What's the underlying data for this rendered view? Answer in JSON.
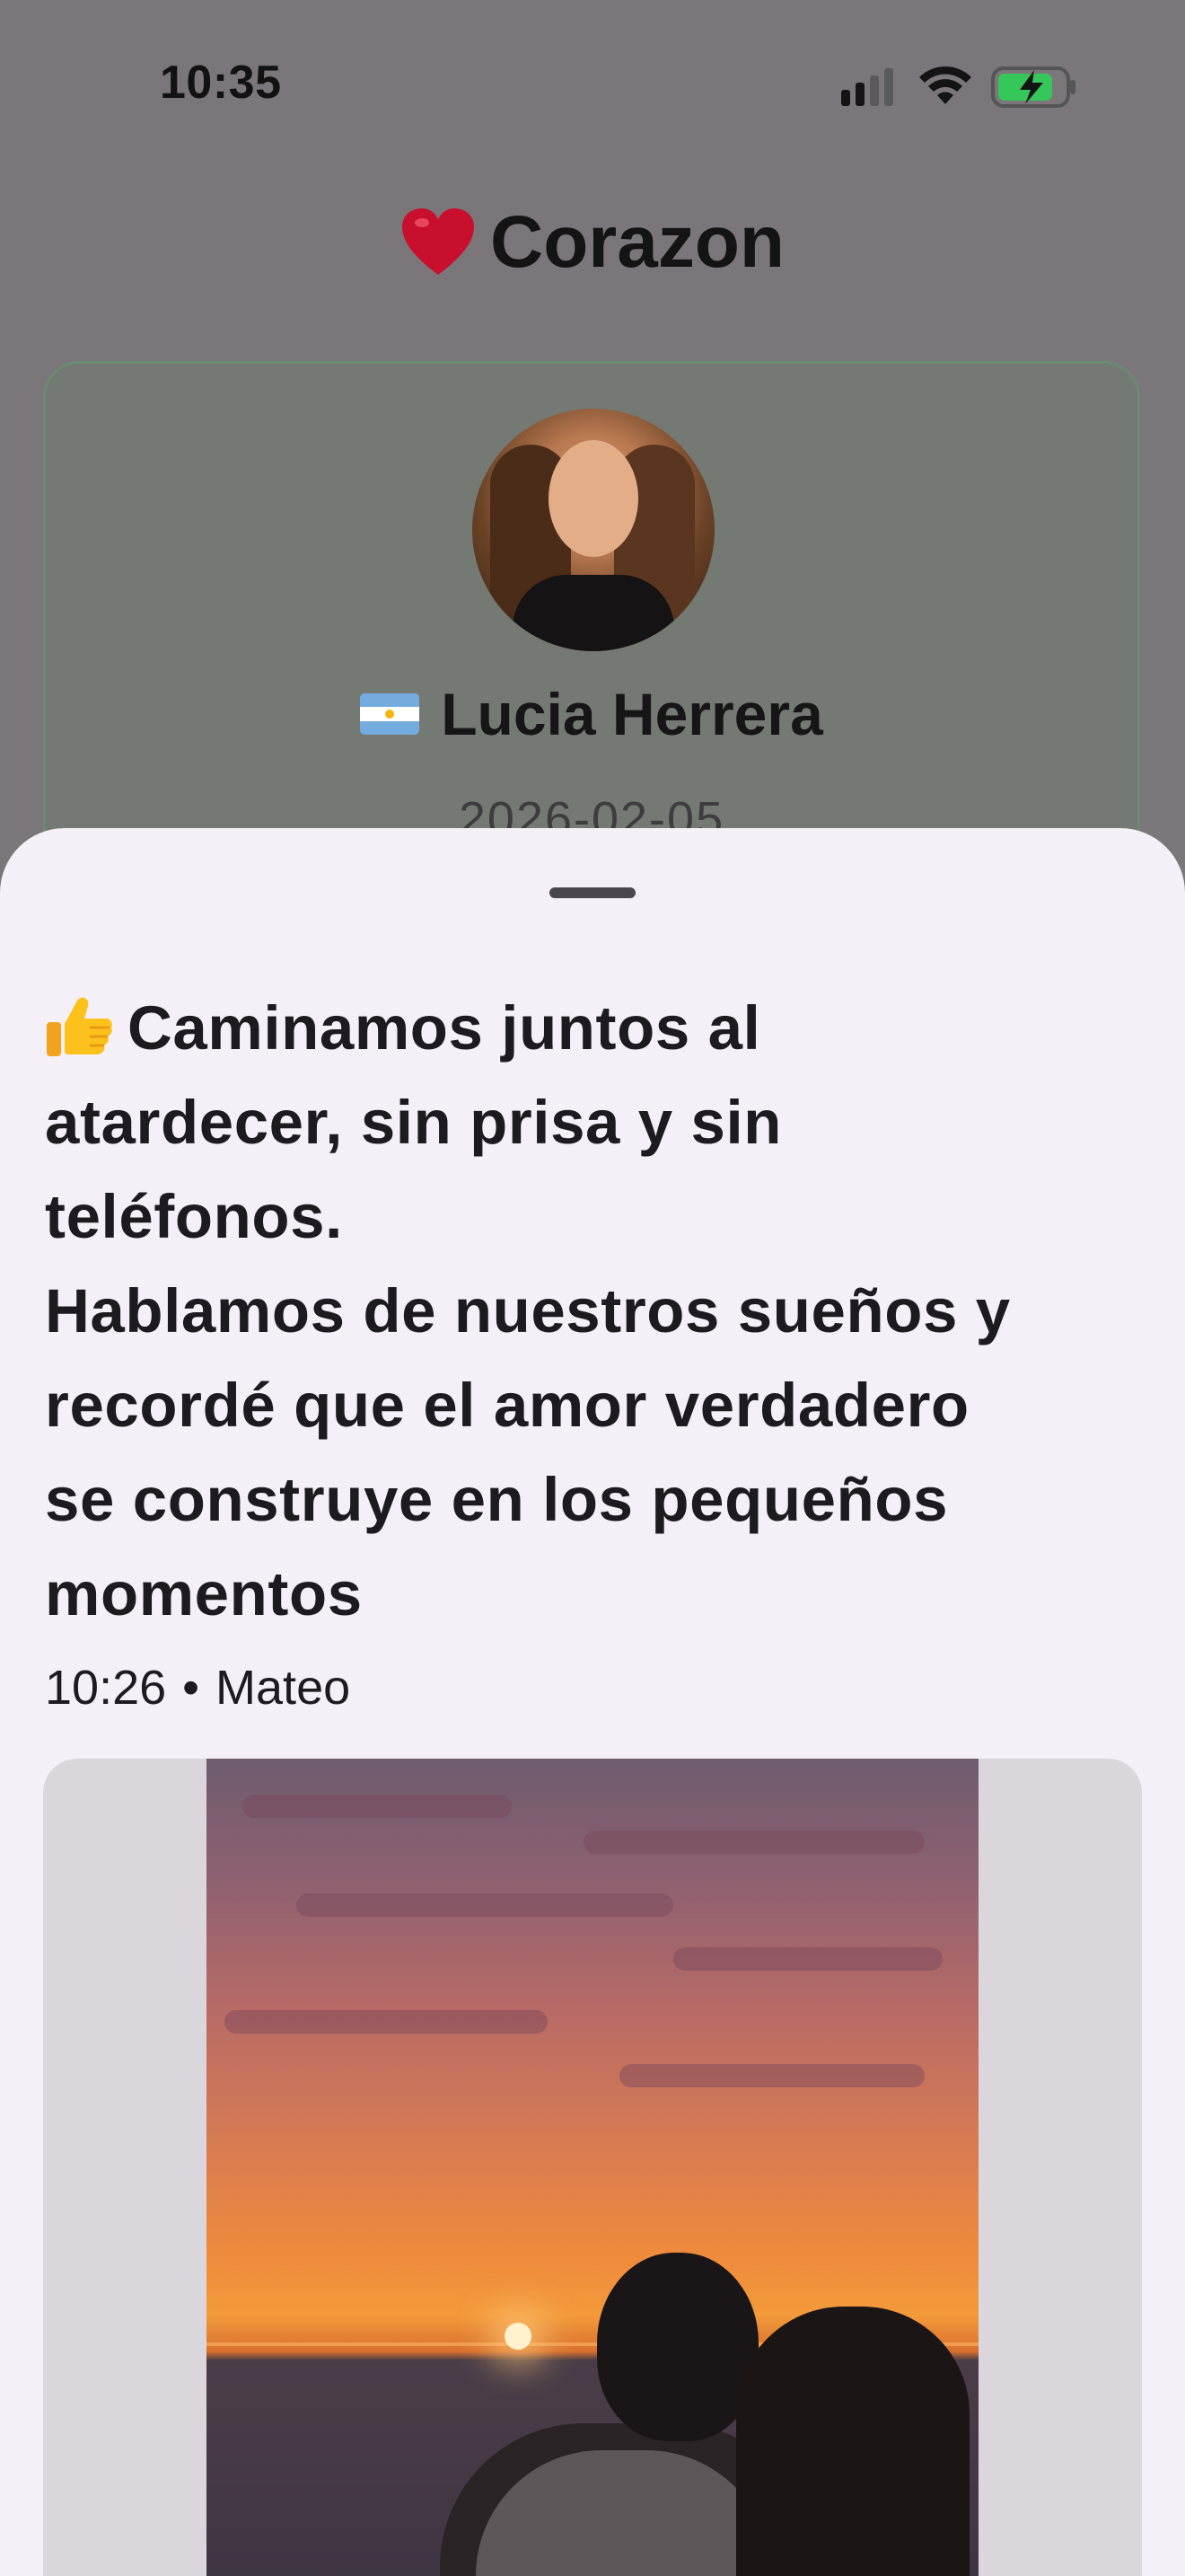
{
  "status_bar": {
    "time": "10:35"
  },
  "header": {
    "title": "Corazon",
    "icon": "red-heart-emoji"
  },
  "profile": {
    "flag": "argentina-flag",
    "name": "Lucia Herrera",
    "date": "2026-02-05"
  },
  "post": {
    "emoji": "thumbs-up",
    "text": "Caminamos juntos al\natardecer, sin prisa y sin\nteléfonos.\nHablamos de nuestros sueños y\nrecordé que el amor verdadero\nse construye en los pequeños\nmomentos",
    "time": "10:26",
    "separator": "•",
    "author": "Mateo"
  },
  "colors": {
    "sheet_bg": "#f5f0f7",
    "card_border": "#6b8a74",
    "heart": "#c8102e"
  }
}
